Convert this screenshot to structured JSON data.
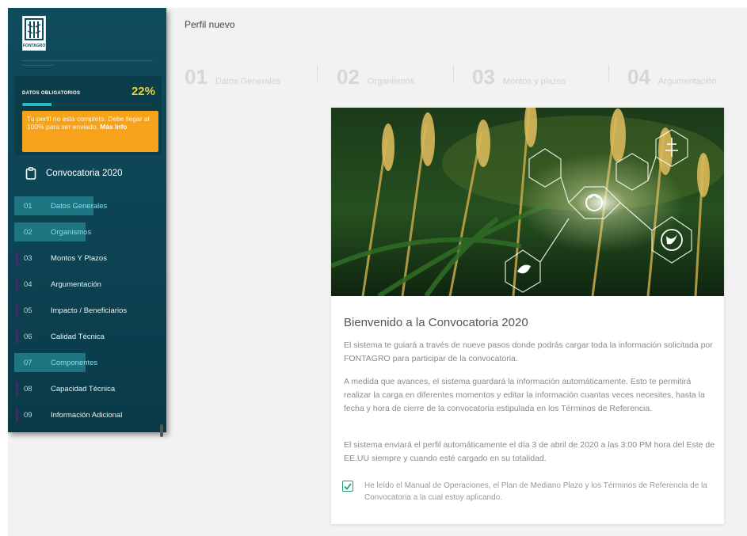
{
  "app": {
    "logo_text": "FONTAGRO",
    "page_title": "Perfil nuevo"
  },
  "progress": {
    "label": "DATOS OBLIGATORIOS",
    "percent_text": "22%",
    "percent": 22,
    "warning_text": "Tu perfil no esta completo. Debe llegar al 100% para ser enviado.",
    "warning_link": "Más Info"
  },
  "sidebar": {
    "title": "Convocatoria 2020",
    "items": [
      {
        "num": "01",
        "label": "Datos Generales",
        "state": "active"
      },
      {
        "num": "02",
        "label": "Organismos",
        "state": "active"
      },
      {
        "num": "03",
        "label": "Montos Y Plazos",
        "state": "pending"
      },
      {
        "num": "04",
        "label": "Argumentación",
        "state": "pending"
      },
      {
        "num": "05",
        "label": "Impacto / Beneficiarios",
        "state": "pending"
      },
      {
        "num": "06",
        "label": "Calidad Técnica",
        "state": "pending"
      },
      {
        "num": "07",
        "label": "Componentes",
        "state": "active"
      },
      {
        "num": "08",
        "label": "Capacidad Técnica",
        "state": "pending"
      },
      {
        "num": "09",
        "label": "Información Adicional",
        "state": "pending"
      }
    ]
  },
  "steps": [
    {
      "num": "01",
      "label": "Datos Generales"
    },
    {
      "num": "02",
      "label": "Organismos"
    },
    {
      "num": "03",
      "label": "Montos y plazos"
    },
    {
      "num": "04",
      "label": "Argumentación"
    }
  ],
  "card": {
    "title": "Bienvenido a la Convocatoria 2020",
    "p1": "El sistema te guiará a través de nueve pasos donde podrás cargar toda la información solicitada por FONTAGRO para participar de la convocatoria.",
    "p2": "A medida que avances, el sistema guardará la información automáticamente. Esto te permitirá realizar la carga en diferentes momentos y editar la información cuantas veces necesites, hasta la fecha y hora de cierre de la convocatoria estipulada en los Términos de Referencia.",
    "p3": "El sistema enviará el perfil automáticamente el día 3 de abril de 2020 a las 3:00 PM hora del Este de EE.UU siempre y cuando esté cargado en su totalidad.",
    "checkbox_label": "He leído el Manual de Operaciones, el Plan de Mediano Plazo y los Términos de Referencia de la Convocatoria a la cual estoy aplicando.",
    "checkbox_checked": true
  },
  "colors": {
    "sidebar": "#0f4c5c",
    "accent": "#2fb7c7",
    "warning": "#f7a21b",
    "percent": "#e8d23a",
    "check": "#1f9c74"
  }
}
